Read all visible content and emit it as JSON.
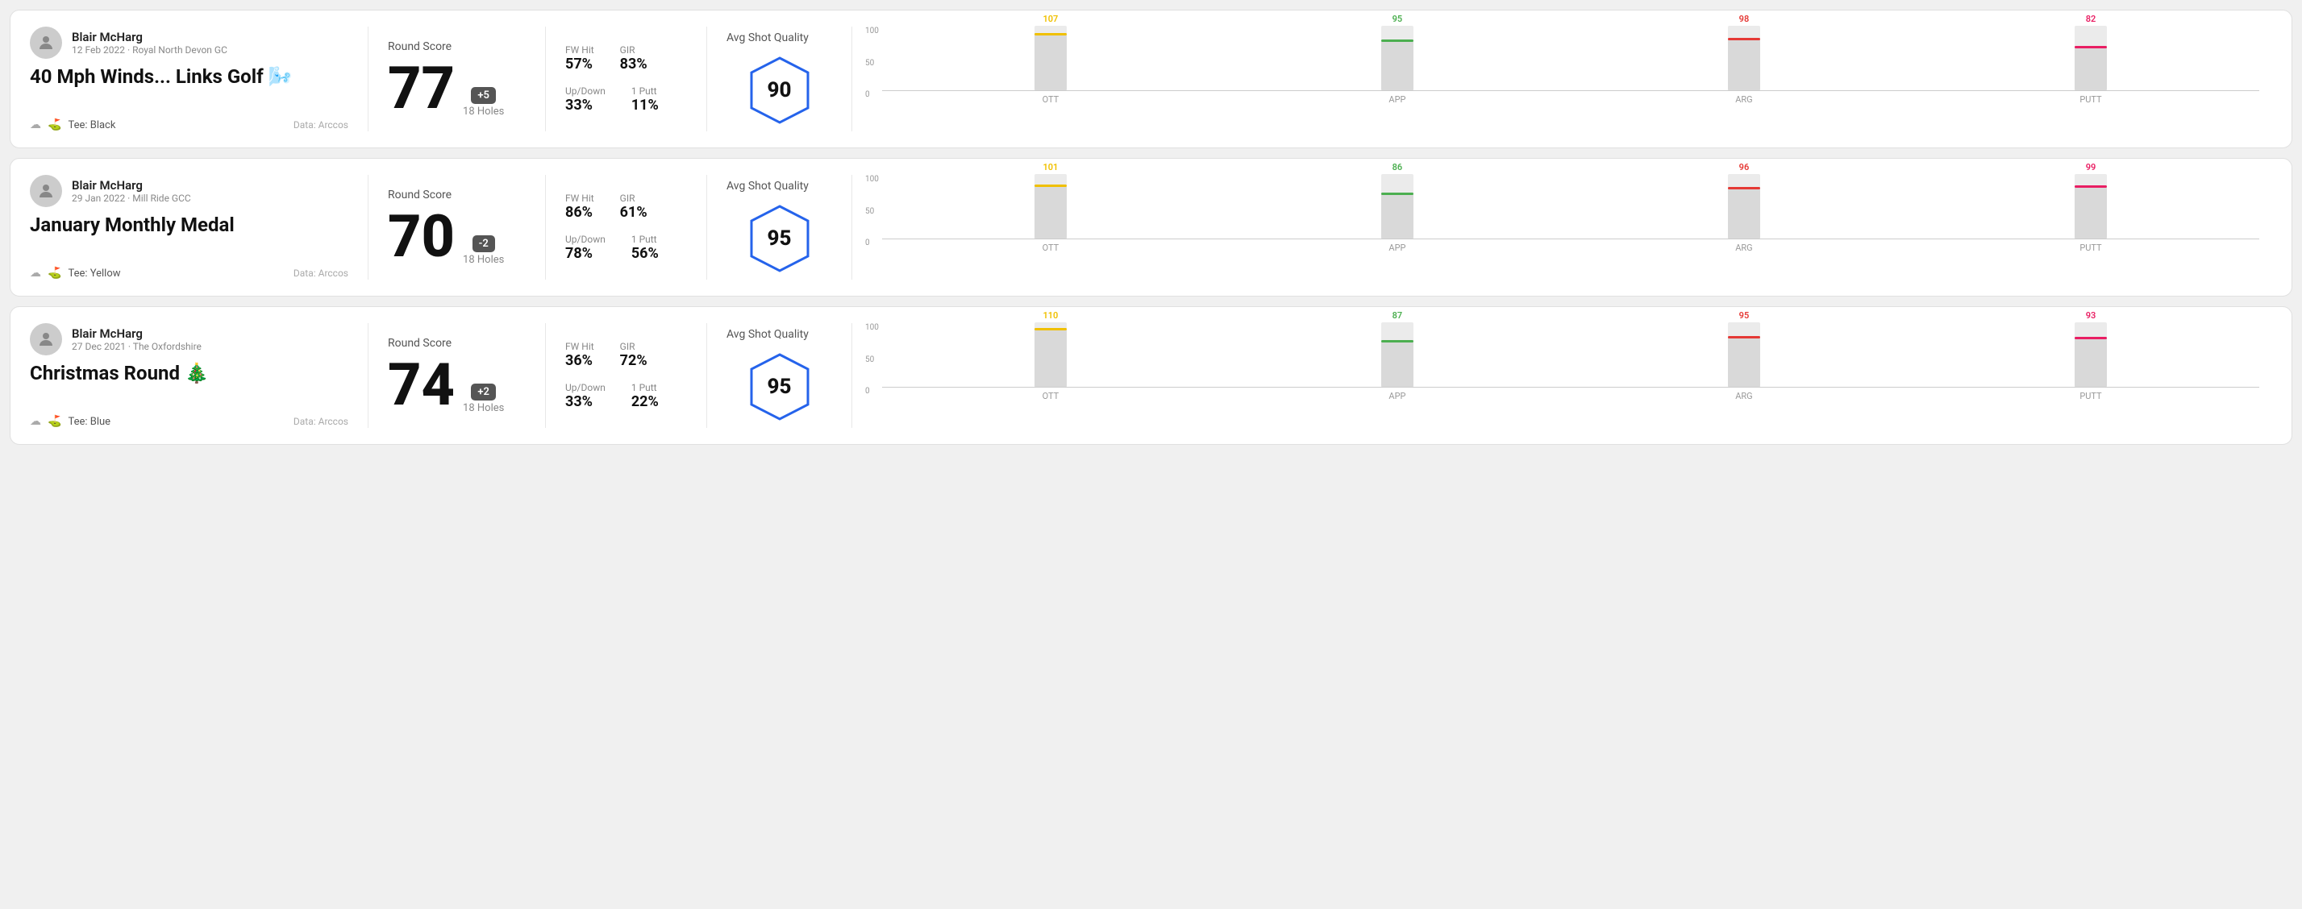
{
  "rounds": [
    {
      "id": "round1",
      "user_name": "Blair McHarg",
      "date": "12 Feb 2022 · Royal North Devon GC",
      "title": "40 Mph Winds... Links Golf 🌬️",
      "tee": "Black",
      "data_source": "Data: Arccos",
      "score": "77",
      "score_diff": "+5",
      "holes": "18 Holes",
      "fw_hit": "57%",
      "gir": "83%",
      "up_down": "33%",
      "one_putt": "11%",
      "avg_quality": "90",
      "chart": {
        "bars": [
          {
            "label": "OTT",
            "value": 107,
            "color": "#f0c000"
          },
          {
            "label": "APP",
            "value": 95,
            "color": "#4caf50"
          },
          {
            "label": "ARG",
            "value": 98,
            "color": "#e53935"
          },
          {
            "label": "PUTT",
            "value": 82,
            "color": "#e91e63"
          }
        ]
      }
    },
    {
      "id": "round2",
      "user_name": "Blair McHarg",
      "date": "29 Jan 2022 · Mill Ride GCC",
      "title": "January Monthly Medal",
      "tee": "Yellow",
      "data_source": "Data: Arccos",
      "score": "70",
      "score_diff": "-2",
      "holes": "18 Holes",
      "fw_hit": "86%",
      "gir": "61%",
      "up_down": "78%",
      "one_putt": "56%",
      "avg_quality": "95",
      "chart": {
        "bars": [
          {
            "label": "OTT",
            "value": 101,
            "color": "#f0c000"
          },
          {
            "label": "APP",
            "value": 86,
            "color": "#4caf50"
          },
          {
            "label": "ARG",
            "value": 96,
            "color": "#e53935"
          },
          {
            "label": "PUTT",
            "value": 99,
            "color": "#e91e63"
          }
        ]
      }
    },
    {
      "id": "round3",
      "user_name": "Blair McHarg",
      "date": "27 Dec 2021 · The Oxfordshire",
      "title": "Christmas Round 🎄",
      "tee": "Blue",
      "data_source": "Data: Arccos",
      "score": "74",
      "score_diff": "+2",
      "holes": "18 Holes",
      "fw_hit": "36%",
      "gir": "72%",
      "up_down": "33%",
      "one_putt": "22%",
      "avg_quality": "95",
      "chart": {
        "bars": [
          {
            "label": "OTT",
            "value": 110,
            "color": "#f0c000"
          },
          {
            "label": "APP",
            "value": 87,
            "color": "#4caf50"
          },
          {
            "label": "ARG",
            "value": 95,
            "color": "#e53935"
          },
          {
            "label": "PUTT",
            "value": 93,
            "color": "#e91e63"
          }
        ]
      }
    }
  ],
  "chart_y_labels": [
    "100",
    "50",
    "0"
  ],
  "stat_labels": {
    "fw_hit": "FW Hit",
    "gir": "GIR",
    "up_down": "Up/Down",
    "one_putt": "1 Putt"
  },
  "section_labels": {
    "round_score": "Round Score",
    "avg_shot_quality": "Avg Shot Quality"
  }
}
